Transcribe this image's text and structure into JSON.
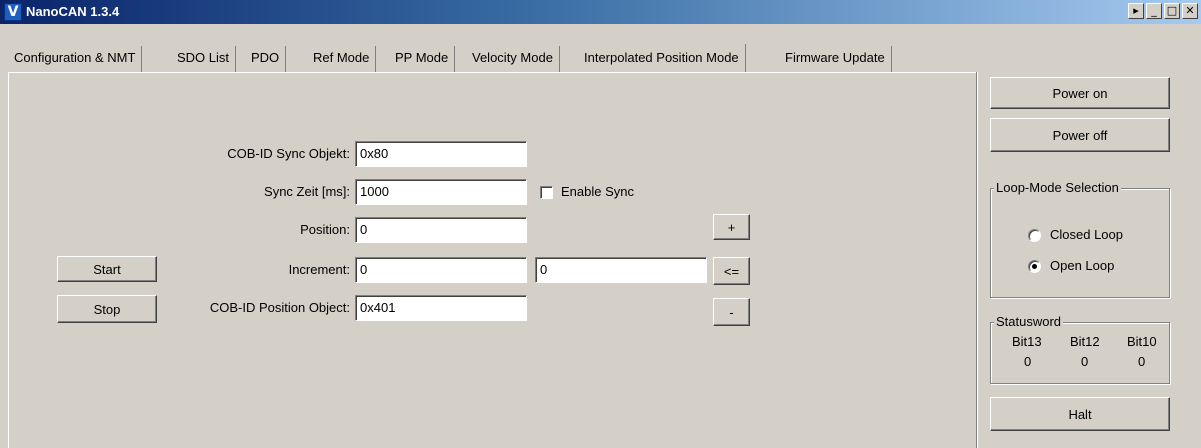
{
  "window": {
    "title": "NanoCAN 1.3.4",
    "logo_glyph": "V",
    "controls": {
      "scroll": "▸",
      "minimize": "_",
      "maximize": "□",
      "close": "✕"
    }
  },
  "tabs": [
    {
      "label": "Configuration & NMT",
      "active": false
    },
    {
      "label": "SDO List",
      "active": false
    },
    {
      "label": "PDO",
      "active": false
    },
    {
      "label": "Ref Mode",
      "active": false
    },
    {
      "label": "PP Mode",
      "active": false
    },
    {
      "label": "Velocity Mode",
      "active": false
    },
    {
      "label": "Interpolated Position Mode",
      "active": true
    },
    {
      "label": "Firmware Update",
      "active": false
    }
  ],
  "form": {
    "cob_sync": {
      "label": "COB-ID Sync Objekt:",
      "value": "0x80"
    },
    "sync_time": {
      "label": "Sync Zeit [ms]:",
      "value": "1000"
    },
    "enable_sync": {
      "label": "Enable Sync",
      "checked": false
    },
    "position": {
      "label": "Position:",
      "value": "0"
    },
    "increment": {
      "label": "Increment:",
      "value": "0",
      "value2": "0"
    },
    "cob_position": {
      "label": "COB-ID Position Object:",
      "value": "0x401"
    }
  },
  "buttons": {
    "start": "Start",
    "stop": "Stop",
    "plus": "+",
    "assign": "<=",
    "minus": "-"
  },
  "sidebar": {
    "power_on": "Power on",
    "power_off": "Power off",
    "loop_mode": {
      "title": "Loop-Mode Selection",
      "closed_loop": "Closed Loop",
      "open_loop": "Open Loop",
      "selected": "Open Loop"
    },
    "statusword": {
      "title": "Statusword",
      "bits": [
        {
          "name": "Bit13",
          "value": "0"
        },
        {
          "name": "Bit12",
          "value": "0"
        },
        {
          "name": "Bit10",
          "value": "0"
        }
      ]
    },
    "halt": "Halt"
  }
}
